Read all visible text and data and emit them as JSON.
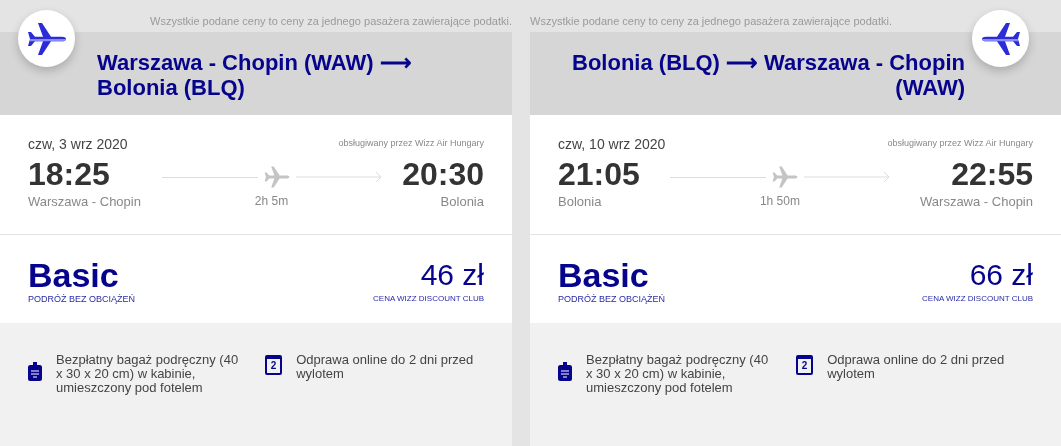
{
  "flights": [
    {
      "kind": "outbound",
      "notice": "Wszystkie podane ceny to ceny za jednego pasażera zawierające podatki.",
      "from": "Warszawa - Chopin (WAW)",
      "arrow": "⟶",
      "to": "Bolonia (BLQ)",
      "date": "czw, 3 wrz 2020",
      "operator": "obsługiwany przez Wizz Air Hungary",
      "departure_time": "18:25",
      "departure_airport": "Warszawa - Chopin",
      "duration": "2h 5m",
      "arrival_time": "20:30",
      "arrival_airport": "Bolonia",
      "fare_name": "Basic",
      "fare_subtitle": "PODRÓŻ BEZ OBCIĄŻEŃ",
      "price": "46 zł",
      "price_note": "CENA WIZZ DISCOUNT CLUB",
      "perks": [
        {
          "kind": "bag",
          "text": "Bezpłatny bagaż podręczny (40 x 30 x 20 cm) w kabinie, umieszczony pod fotelem"
        },
        {
          "kind": "calendar",
          "icon_text": "2",
          "text": "Odprawa online do 2 dni przed wylotem"
        }
      ]
    },
    {
      "kind": "return",
      "notice": "Wszystkie podane ceny to ceny za jednego pasażera zawierające podatki.",
      "from": "Bolonia (BLQ)",
      "arrow": "⟶",
      "to": "Warszawa - Chopin (WAW)",
      "date": "czw, 10 wrz 2020",
      "operator": "obsługiwany przez Wizz Air Hungary",
      "departure_time": "21:05",
      "departure_airport": "Bolonia",
      "duration": "1h 50m",
      "arrival_time": "22:55",
      "arrival_airport": "Warszawa - Chopin",
      "fare_name": "Basic",
      "fare_subtitle": "PODRÓŻ BEZ OBCIĄŻEŃ",
      "price": "66 zł",
      "price_note": "CENA WIZZ DISCOUNT CLUB",
      "perks": [
        {
          "kind": "bag",
          "text": "Bezpłatny bagaż podręczny (40 x 30 x 20 cm) w kabinie, umieszczony pod fotelem"
        },
        {
          "kind": "calendar",
          "icon_text": "2",
          "text": "Odprawa online do 2 dni przed wylotem"
        }
      ]
    }
  ]
}
